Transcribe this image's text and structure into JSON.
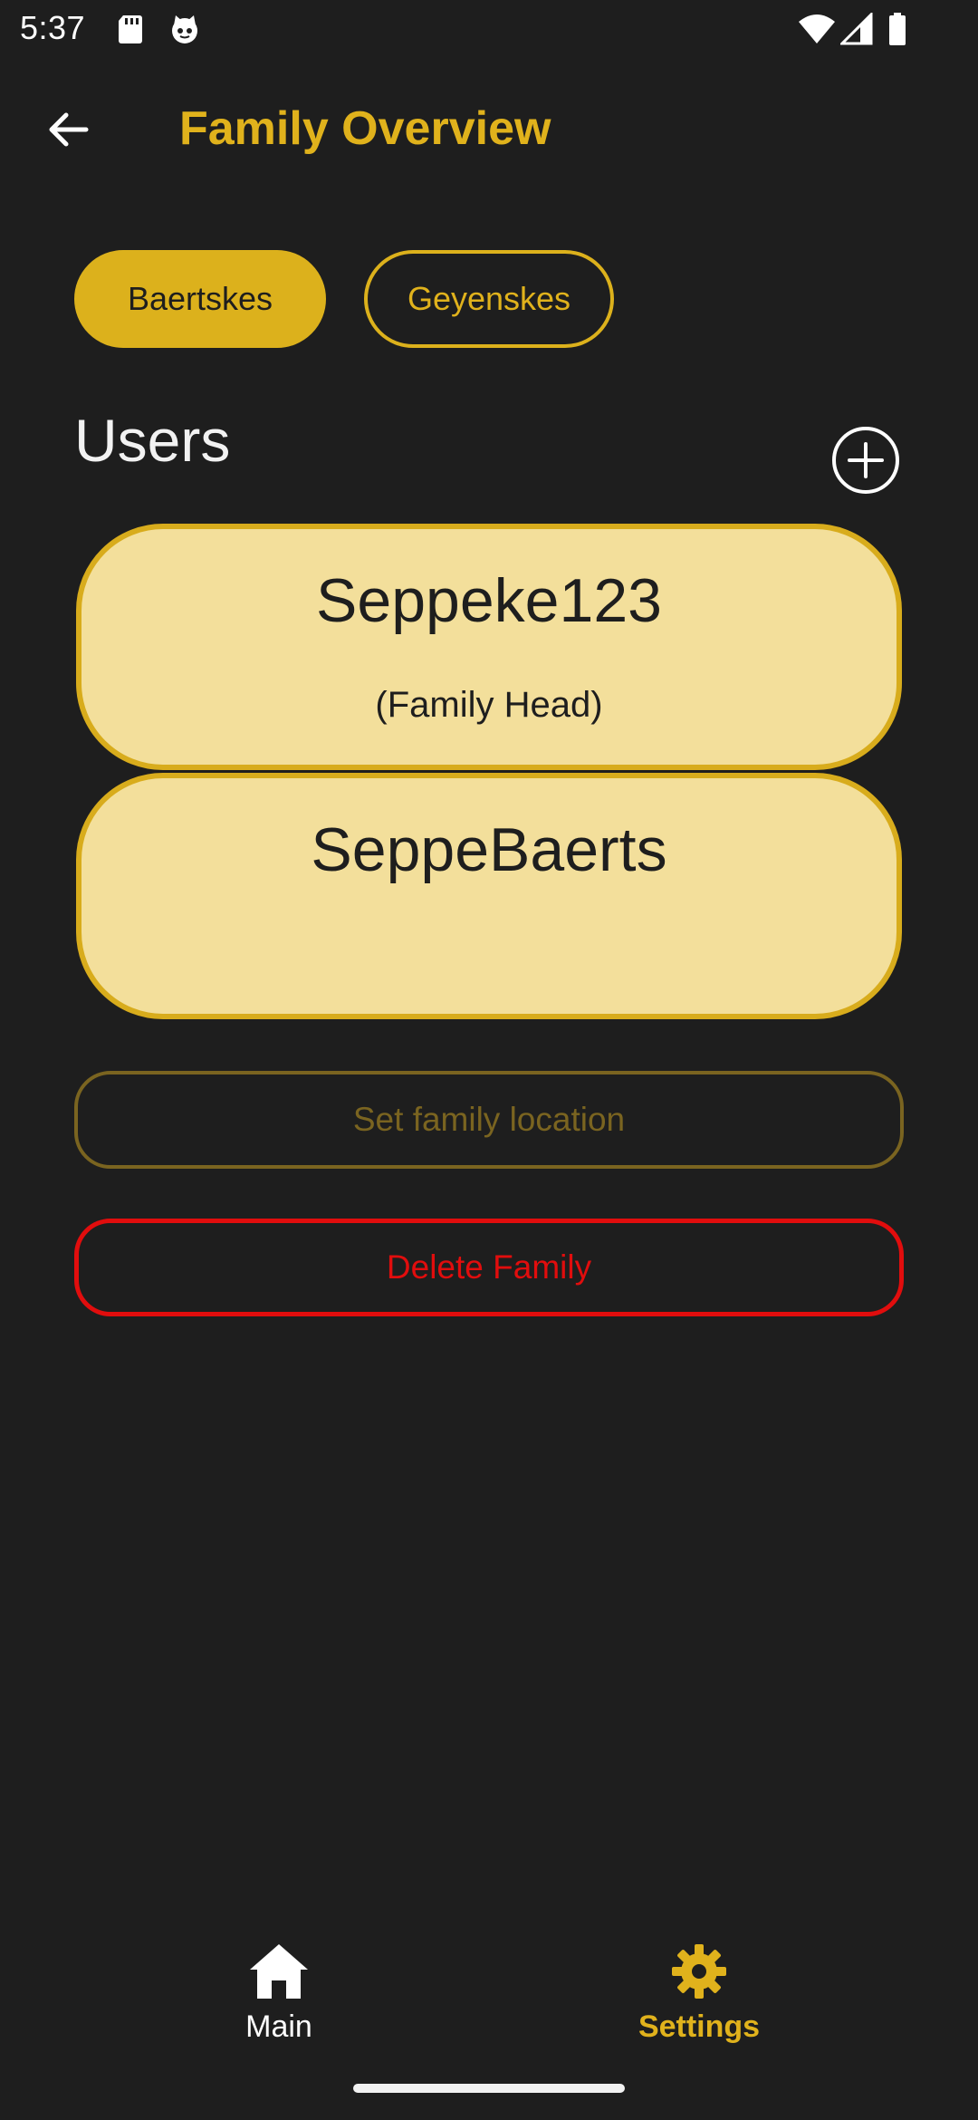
{
  "status_bar": {
    "time": "5:37",
    "icons": [
      "sd-card-icon",
      "cat-face-icon",
      "wifi-icon",
      "signal-icon",
      "battery-icon"
    ]
  },
  "app_bar": {
    "title": "Family Overview",
    "back_icon": "arrow-left-icon"
  },
  "family_tabs": [
    {
      "label": "Baertskes",
      "selected": true
    },
    {
      "label": "Geyenskes",
      "selected": false
    }
  ],
  "users_section": {
    "title": "Users",
    "add_icon": "plus-circle-icon",
    "users": [
      {
        "name": "Seppeke123",
        "role": "(Family Head)"
      },
      {
        "name": "SeppeBaerts",
        "role": ""
      }
    ]
  },
  "actions": {
    "set_location_label": "Set family location",
    "delete_family_label": "Delete Family"
  },
  "bottom_nav": [
    {
      "label": "Main",
      "icon": "home-icon",
      "active": false
    },
    {
      "label": "Settings",
      "icon": "gear-icon",
      "active": true
    }
  ],
  "colors": {
    "background": "#1e1e1e",
    "accent": "#e0b21c",
    "card_fill": "#f3df9b",
    "danger": "#e10d0d",
    "muted_accent": "#7a6420"
  }
}
